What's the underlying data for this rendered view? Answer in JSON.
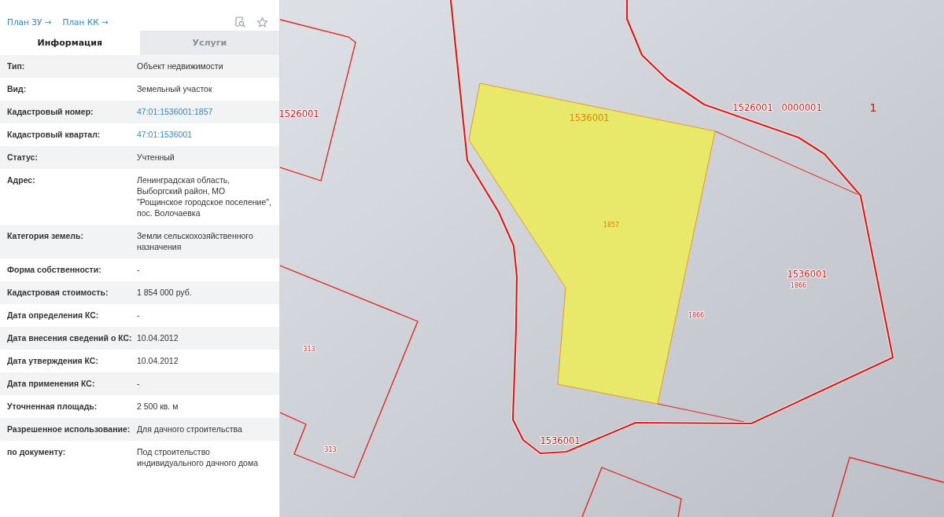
{
  "panel": {
    "links": [
      {
        "label": "План ЗУ →"
      },
      {
        "label": "План КК →"
      }
    ],
    "tabs": [
      {
        "label": "Информация",
        "selected": true
      },
      {
        "label": "Услуги",
        "selected": false
      }
    ],
    "rows": [
      {
        "label": "Тип:",
        "value": "Объект недвижимости",
        "kind": "text"
      },
      {
        "label": "Вид:",
        "value": "Земельный участок",
        "kind": "text"
      },
      {
        "label": "Кадастровый номер:",
        "value": "47:01:1536001:1857",
        "kind": "link"
      },
      {
        "label": "Кадастровый квартал:",
        "value": "47:01:1536001",
        "kind": "link"
      },
      {
        "label": "Статус:",
        "value": "Учтенный",
        "kind": "text"
      },
      {
        "label": "Адрес:",
        "value": "Ленинградская область, Выборгский район, МО \"Рощинское городское поселение\", пос. Волочаевка",
        "kind": "text"
      },
      {
        "label": "Категория земель:",
        "value": "Земли сельскохозяйственного назначения",
        "kind": "text"
      },
      {
        "label": "Форма собственности:",
        "value": "-",
        "kind": "text"
      },
      {
        "label": "Кадастровая стоимость:",
        "value": "1 854 000 руб.",
        "kind": "text"
      },
      {
        "label": "Дата определения КС:",
        "value": "-",
        "kind": "text"
      },
      {
        "label": "Дата внесения сведений о КС:",
        "value": "10.04.2012",
        "kind": "text"
      },
      {
        "label": "Дата утверждения КС:",
        "value": "10.04.2012",
        "kind": "text"
      },
      {
        "label": "Дата применения КС:",
        "value": "-",
        "kind": "text"
      },
      {
        "label": "Уточненная площадь:",
        "value": "2 500 кв. м",
        "kind": "text"
      },
      {
        "label": "Разрешенное использование:",
        "value": "Для дачного строительства",
        "kind": "text"
      },
      {
        "label": "по документу:",
        "value": "Под строительство индивидуального дачного дома",
        "kind": "text"
      }
    ]
  },
  "map": {
    "labels": [
      {
        "text": "1526001",
        "kind": "quarter",
        "highlighted": false
      },
      {
        "text": "1536001",
        "kind": "quarter",
        "highlighted": true
      },
      {
        "text": "1526001   0000001",
        "kind": "quarter",
        "highlighted": false
      },
      {
        "text": "1",
        "kind": "zone",
        "highlighted": false
      },
      {
        "text": "1857",
        "kind": "parcel",
        "highlighted": true
      },
      {
        "text": "1536001",
        "kind": "quarter",
        "highlighted": false
      },
      {
        "text": "1866",
        "kind": "parcel",
        "highlighted": false
      },
      {
        "text": "1866",
        "kind": "parcel",
        "highlighted": false
      },
      {
        "text": "313",
        "kind": "parcel",
        "highlighted": false
      },
      {
        "text": "313",
        "kind": "parcel",
        "highlighted": false
      },
      {
        "text": "1536001",
        "kind": "quarter",
        "highlighted": false
      }
    ]
  }
}
